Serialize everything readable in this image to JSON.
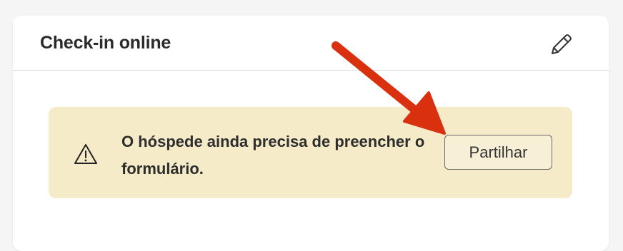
{
  "card": {
    "title": "Check-in online",
    "edit_icon": "pencil-icon"
  },
  "notice": {
    "icon": "warning-triangle-icon",
    "message": "O hóspede ainda precisa de preencher o formulário.",
    "action_label": "Partilhar"
  },
  "annotation": {
    "icon": "red-arrow-annotation"
  },
  "colors": {
    "page_bg": "#f5f5f5",
    "card_bg": "#ffffff",
    "notice_bg": "#f5ebc9",
    "title_text": "#2a2a2a",
    "arrow": "#d9300f"
  }
}
